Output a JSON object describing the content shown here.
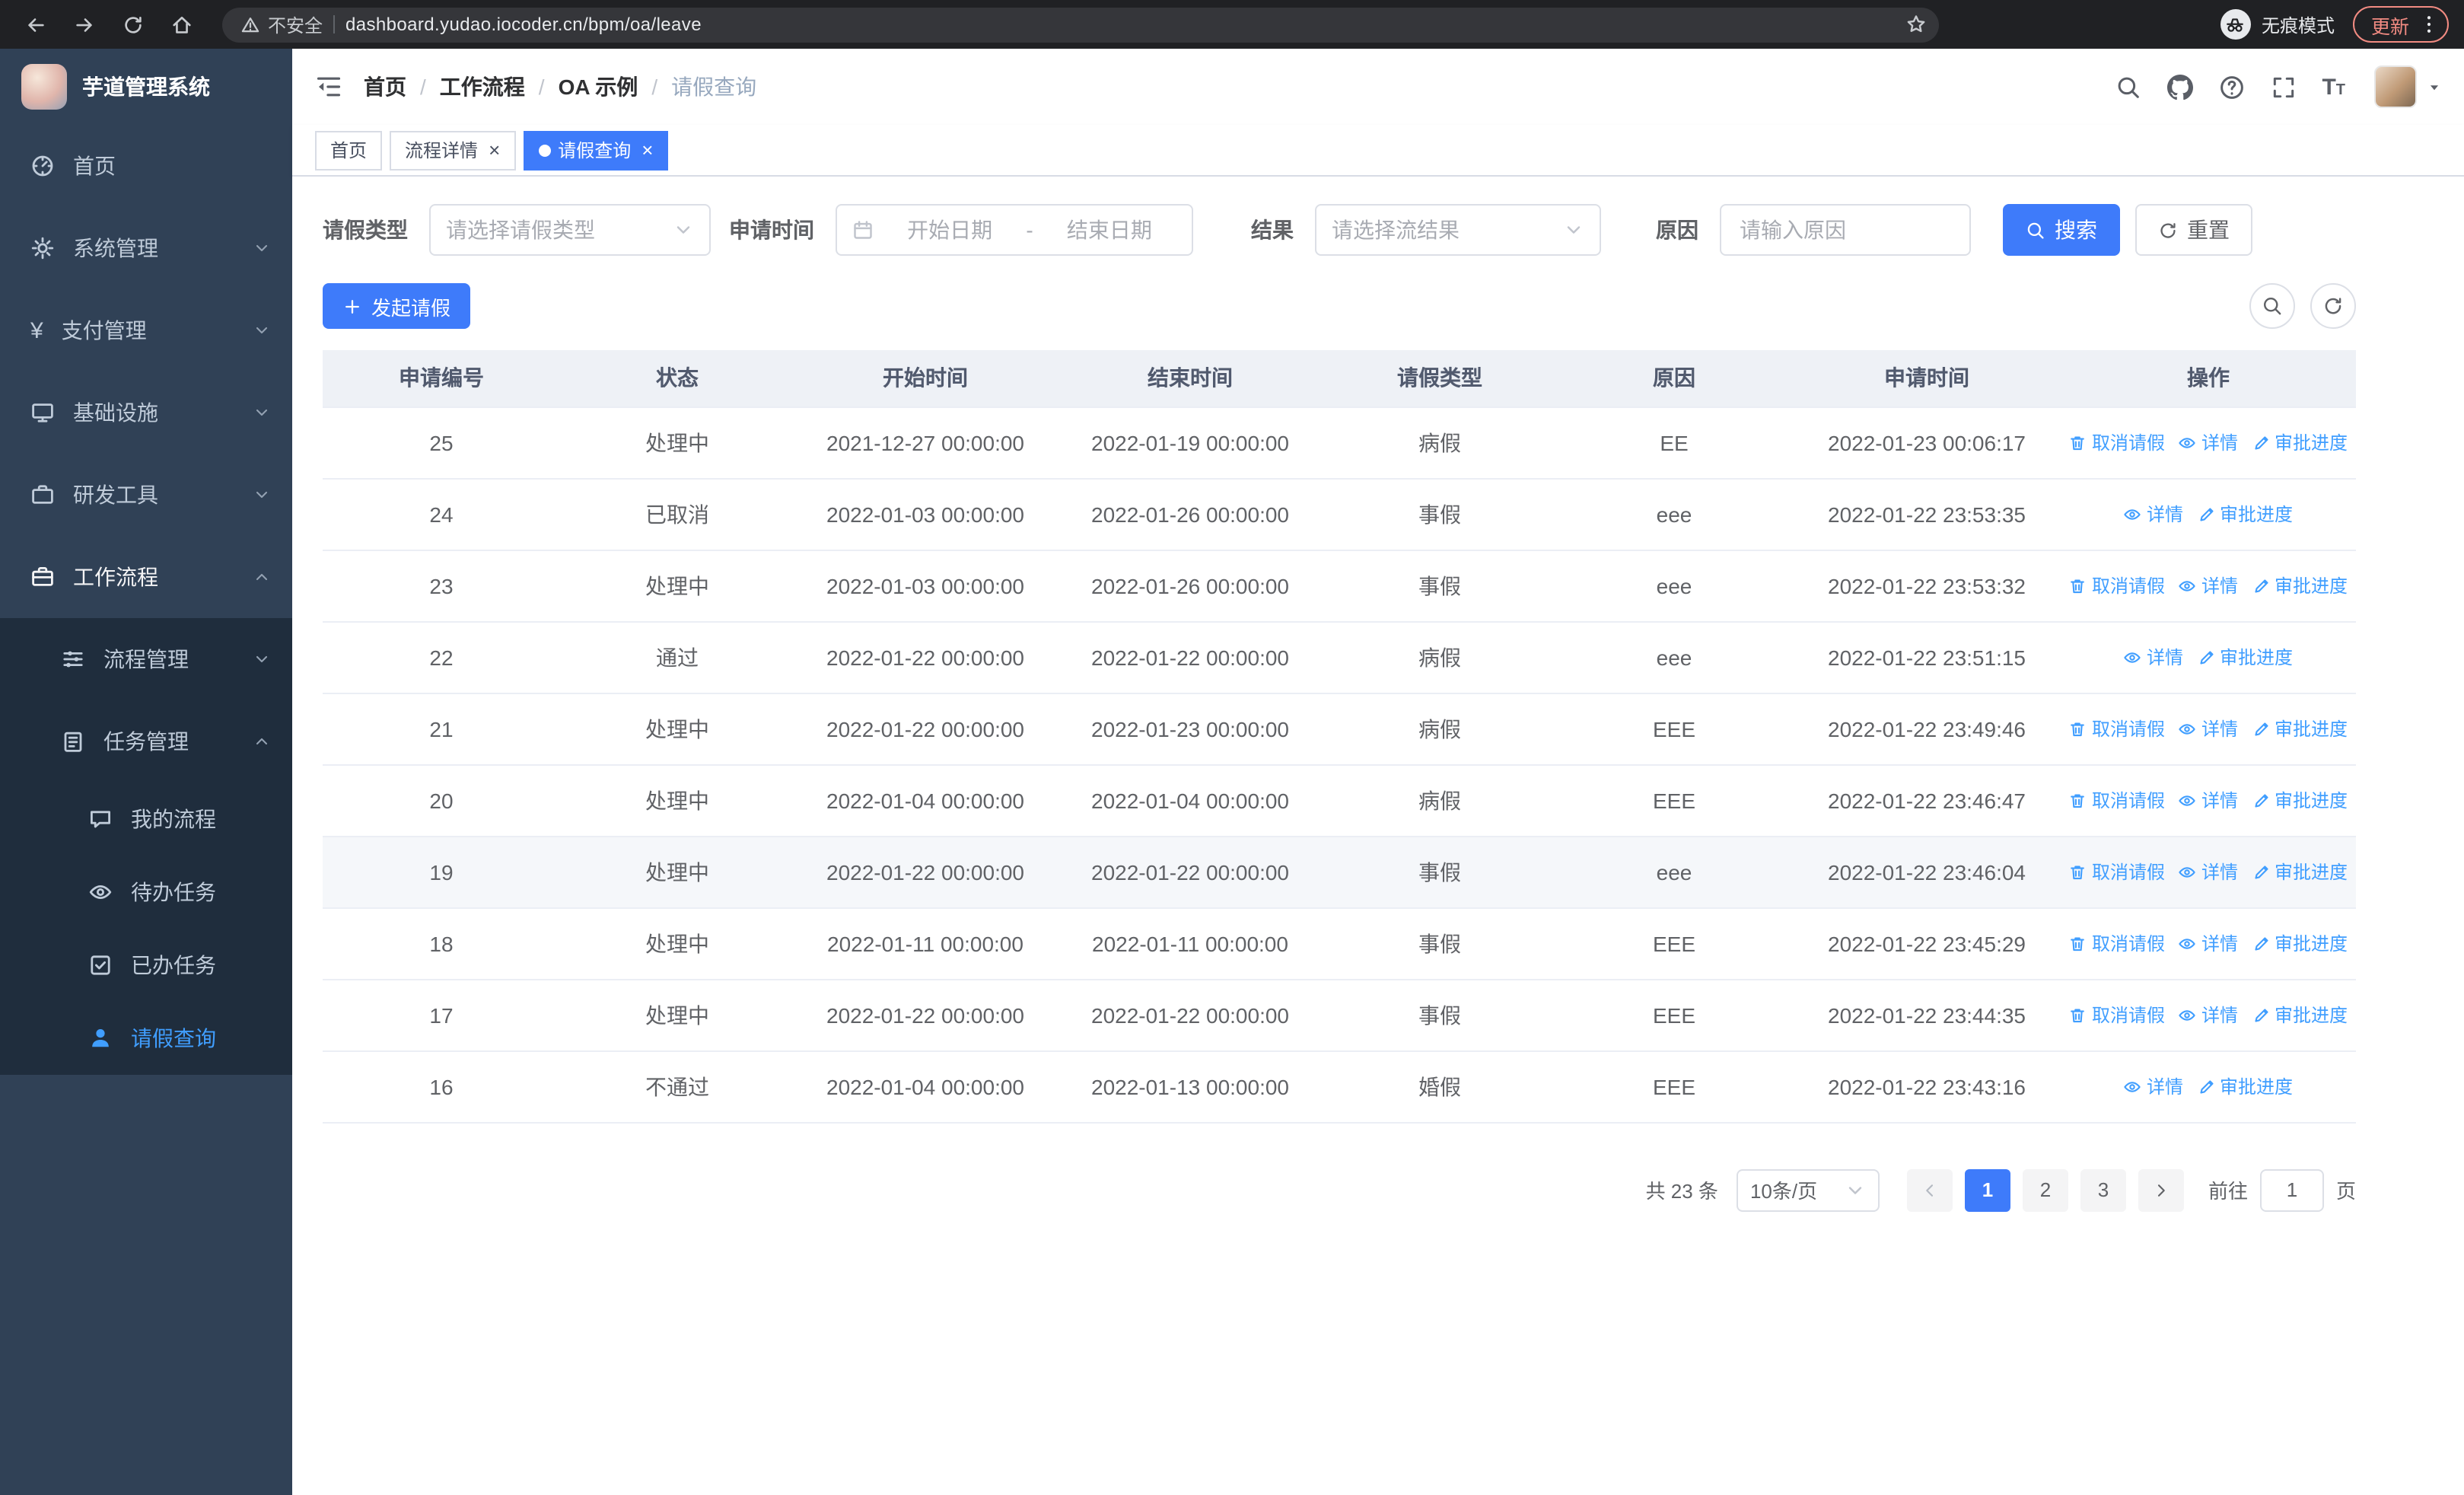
{
  "colors": {
    "primary": "#3e7bfa",
    "link": "#409eff",
    "sidebar_bg": "#304156",
    "submenu_bg": "#1f2d3d",
    "sidebar_text": "#bfcbd9"
  },
  "browser": {
    "security_warning": "不安全",
    "url": "dashboard.yudao.iocoder.cn/bpm/oa/leave",
    "incognito_label": "无痕模式",
    "update_button": "更新"
  },
  "sidebar": {
    "logo_title": "芋道管理系统",
    "menu": [
      {
        "name": "home",
        "label": "首页",
        "icon": "dashboard",
        "level": 1
      },
      {
        "name": "system-management",
        "label": "系统管理",
        "icon": "gear",
        "level": 1,
        "arrow": "down"
      },
      {
        "name": "payment-management",
        "label": "支付管理",
        "icon": "yen",
        "level": 1,
        "arrow": "down"
      },
      {
        "name": "infrastructure",
        "label": "基础设施",
        "icon": "monitor",
        "level": 1,
        "arrow": "down"
      },
      {
        "name": "dev-tools",
        "label": "研发工具",
        "icon": "toolbox",
        "level": 1,
        "arrow": "down"
      },
      {
        "name": "workflow",
        "label": "工作流程",
        "icon": "briefcase",
        "level": 1,
        "arrow": "up",
        "highlight": true
      },
      {
        "name": "process-management",
        "label": "流程管理",
        "icon": "sliders",
        "level": 2,
        "submenu": true,
        "arrow": "down"
      },
      {
        "name": "task-management",
        "label": "任务管理",
        "icon": "clipboard",
        "level": 2,
        "submenu": true,
        "arrow": "up"
      },
      {
        "name": "my-processes",
        "label": "我的流程",
        "icon": "chat",
        "level": 3,
        "submenu": true
      },
      {
        "name": "todo-tasks",
        "label": "待办任务",
        "icon": "eye",
        "level": 3,
        "submenu": true
      },
      {
        "name": "done-tasks",
        "label": "已办任务",
        "icon": "check-square",
        "level": 3,
        "submenu": true
      },
      {
        "name": "leave-query",
        "label": "请假查询",
        "icon": "user",
        "level": 3,
        "submenu": true,
        "active": true
      }
    ]
  },
  "header": {
    "breadcrumb": [
      "首页",
      "工作流程",
      "OA 示例",
      "请假查询"
    ],
    "breadcrumb_separator": "/"
  },
  "tags": [
    {
      "name": "tab-home",
      "label": "首页",
      "closable": false,
      "active": false
    },
    {
      "name": "tab-process-detail",
      "label": "流程详情",
      "closable": true,
      "active": false
    },
    {
      "name": "tab-leave-query",
      "label": "请假查询",
      "closable": true,
      "active": true
    }
  ],
  "filters": {
    "leave_type_label": "请假类型",
    "leave_type_placeholder": "请选择请假类型",
    "apply_time_label": "申请时间",
    "start_date_placeholder": "开始日期",
    "range_separator": "-",
    "end_date_placeholder": "结束日期",
    "result_label": "结果",
    "result_placeholder": "请选择流结果",
    "reason_label": "原因",
    "reason_placeholder": "请输入原因",
    "search_button": "搜索",
    "reset_button": "重置"
  },
  "toolbar": {
    "create_button": "发起请假"
  },
  "table": {
    "columns": [
      "申请编号",
      "状态",
      "开始时间",
      "结束时间",
      "请假类型",
      "原因",
      "申请时间",
      "操作"
    ],
    "actions": {
      "cancel": "取消请假",
      "detail": "详情",
      "progress": "审批进度"
    },
    "rows": [
      {
        "id": "25",
        "status": "处理中",
        "start": "2021-12-27 00:00:00",
        "end": "2022-01-19 00:00:00",
        "type": "病假",
        "reason": "EE",
        "applied": "2022-01-23 00:06:17",
        "cancellable": true
      },
      {
        "id": "24",
        "status": "已取消",
        "start": "2022-01-03 00:00:00",
        "end": "2022-01-26 00:00:00",
        "type": "事假",
        "reason": "eee",
        "applied": "2022-01-22 23:53:35",
        "cancellable": false
      },
      {
        "id": "23",
        "status": "处理中",
        "start": "2022-01-03 00:00:00",
        "end": "2022-01-26 00:00:00",
        "type": "事假",
        "reason": "eee",
        "applied": "2022-01-22 23:53:32",
        "cancellable": true
      },
      {
        "id": "22",
        "status": "通过",
        "start": "2022-01-22 00:00:00",
        "end": "2022-01-22 00:00:00",
        "type": "病假",
        "reason": "eee",
        "applied": "2022-01-22 23:51:15",
        "cancellable": false
      },
      {
        "id": "21",
        "status": "处理中",
        "start": "2022-01-22 00:00:00",
        "end": "2022-01-23 00:00:00",
        "type": "病假",
        "reason": "EEE",
        "applied": "2022-01-22 23:49:46",
        "cancellable": true
      },
      {
        "id": "20",
        "status": "处理中",
        "start": "2022-01-04 00:00:00",
        "end": "2022-01-04 00:00:00",
        "type": "病假",
        "reason": "EEE",
        "applied": "2022-01-22 23:46:47",
        "cancellable": true
      },
      {
        "id": "19",
        "status": "处理中",
        "start": "2022-01-22 00:00:00",
        "end": "2022-01-22 00:00:00",
        "type": "事假",
        "reason": "eee",
        "applied": "2022-01-22 23:46:04",
        "cancellable": true,
        "highlighted": true
      },
      {
        "id": "18",
        "status": "处理中",
        "start": "2022-01-11 00:00:00",
        "end": "2022-01-11 00:00:00",
        "type": "事假",
        "reason": "EEE",
        "applied": "2022-01-22 23:45:29",
        "cancellable": true
      },
      {
        "id": "17",
        "status": "处理中",
        "start": "2022-01-22 00:00:00",
        "end": "2022-01-22 00:00:00",
        "type": "事假",
        "reason": "EEE",
        "applied": "2022-01-22 23:44:35",
        "cancellable": true
      },
      {
        "id": "16",
        "status": "不通过",
        "start": "2022-01-04 00:00:00",
        "end": "2022-01-13 00:00:00",
        "type": "婚假",
        "reason": "EEE",
        "applied": "2022-01-22 23:43:16",
        "cancellable": false
      }
    ]
  },
  "pagination": {
    "total_text": "共 23 条",
    "page_size": "10条/页",
    "pages": [
      "1",
      "2",
      "3"
    ],
    "current_page": "1",
    "goto_label": "前往",
    "goto_value": "1",
    "page_suffix": "页"
  }
}
